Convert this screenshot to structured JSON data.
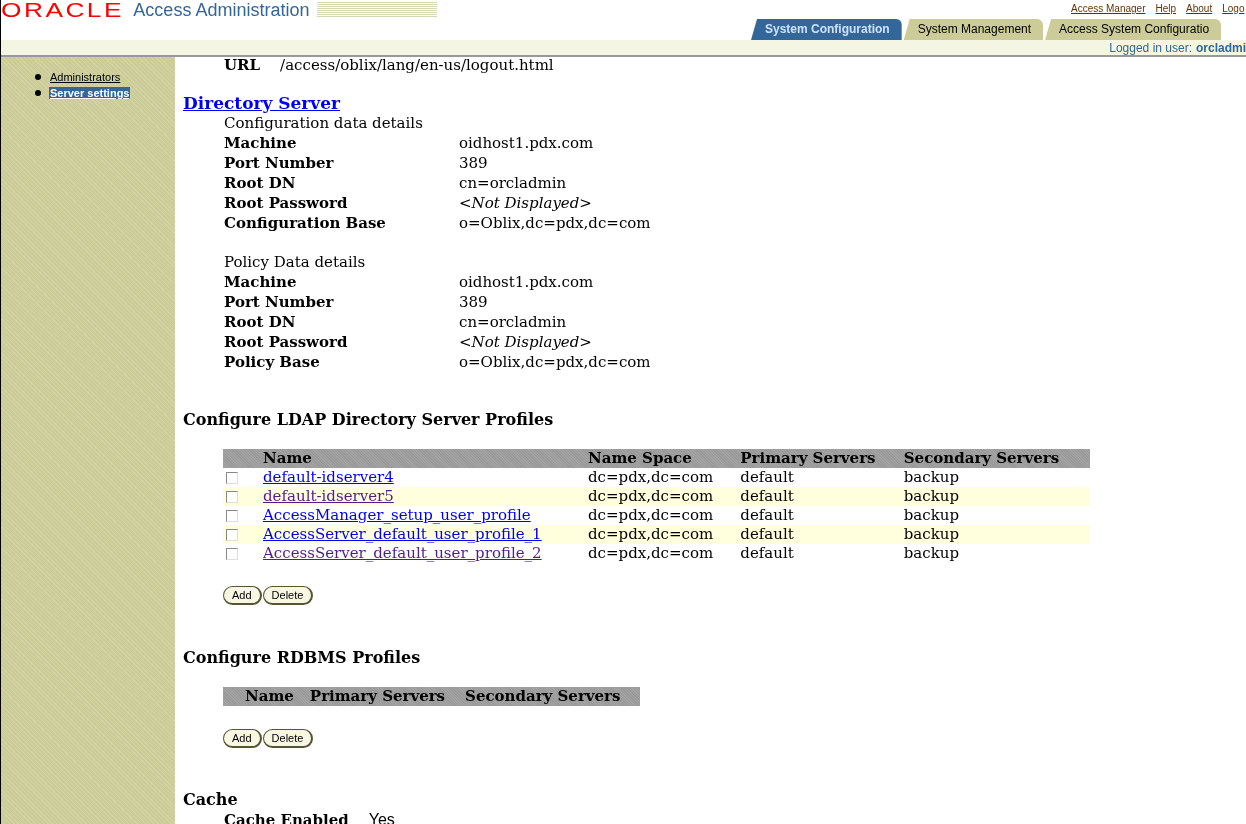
{
  "header": {
    "logo": "ORACLE",
    "title": "Access Administration",
    "links": [
      "Access Manager",
      "Help",
      "About",
      "Logo"
    ],
    "tabs": [
      {
        "label": "System Configuration",
        "selected": true
      },
      {
        "label": "System Management",
        "selected": false
      },
      {
        "label": "Access System Configuratio",
        "selected": false
      }
    ],
    "logged_in_label": "Logged in user:",
    "logged_in_user": "orcladmi"
  },
  "sidebar": {
    "items": [
      {
        "label": "Administrators",
        "selected": false
      },
      {
        "label": "Server settings",
        "selected": true
      }
    ]
  },
  "url_row": {
    "label": "URL",
    "value": "/access/oblix/lang/en-us/logout.html"
  },
  "directory_server": {
    "title": "Directory Server",
    "groups": [
      {
        "caption": "Configuration data details",
        "fields": [
          {
            "label": "Machine",
            "value": "oidhost1.pdx.com",
            "kind": "text"
          },
          {
            "label": "Port Number",
            "value": "389",
            "kind": "text"
          },
          {
            "label": "Root DN",
            "value": "cn=orcladmin",
            "kind": "text"
          },
          {
            "label": "Root Password",
            "value": "<Not Displayed>",
            "kind": "masked"
          },
          {
            "label": "Configuration Base",
            "value": "o=Oblix,dc=pdx,dc=com",
            "kind": "text"
          }
        ]
      },
      {
        "caption": "Policy Data details",
        "fields": [
          {
            "label": "Machine",
            "value": "oidhost1.pdx.com",
            "kind": "text"
          },
          {
            "label": "Port Number",
            "value": "389",
            "kind": "text"
          },
          {
            "label": "Root DN",
            "value": "cn=orcladmin",
            "kind": "text"
          },
          {
            "label": "Root Password",
            "value": "<Not Displayed>",
            "kind": "masked"
          },
          {
            "label": "Policy Base",
            "value": "o=Oblix,dc=pdx,dc=com",
            "kind": "text"
          }
        ]
      }
    ]
  },
  "ldap_profiles": {
    "title": "Configure LDAP Directory Server Profiles",
    "columns": [
      "Name",
      "Name Space",
      "Primary Servers",
      "Secondary Servers"
    ],
    "rows": [
      {
        "checked": false,
        "name": "default-idserver4",
        "visited": false,
        "name_space": "dc=pdx,dc=com",
        "primary": "default",
        "secondary": "backup"
      },
      {
        "checked": false,
        "name": "default-idserver5",
        "visited": true,
        "name_space": "dc=pdx,dc=com",
        "primary": "default",
        "secondary": "backup"
      },
      {
        "checked": false,
        "name": "AccessManager_setup_user_profile",
        "visited": false,
        "name_space": "dc=pdx,dc=com",
        "primary": "default",
        "secondary": "backup"
      },
      {
        "checked": false,
        "name": "AccessServer_default_user_profile_1",
        "visited": false,
        "name_space": "dc=pdx,dc=com",
        "primary": "default",
        "secondary": "backup"
      },
      {
        "checked": false,
        "name": "AccessServer_default_user_profile_2",
        "visited": true,
        "name_space": "dc=pdx,dc=com",
        "primary": "default",
        "secondary": "backup"
      }
    ],
    "buttons": [
      "Add",
      "Delete"
    ]
  },
  "rdbms_profiles": {
    "title": "Configure RDBMS Profiles",
    "columns": [
      "Name",
      "Primary Servers",
      "Secondary Servers"
    ],
    "buttons": [
      "Add",
      "Delete"
    ]
  },
  "cache": {
    "title": "Cache",
    "fields": [
      {
        "label": "Cache Enabled",
        "value": "Yes"
      }
    ]
  }
}
